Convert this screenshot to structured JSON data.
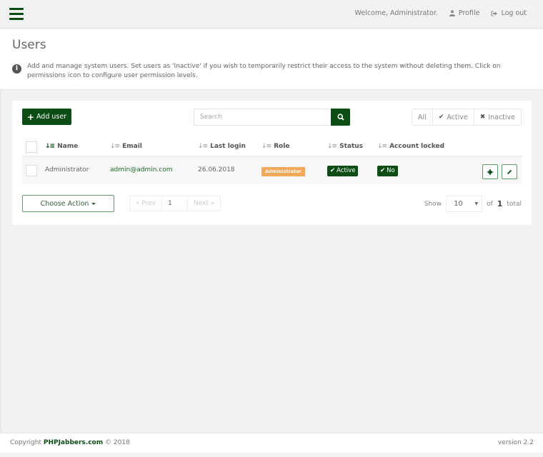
{
  "topbar": {
    "menu_icon": "hamburger-menu-icon",
    "welcome": "Welcome, Administrator.",
    "profile_label": "Profile",
    "profile_icon": "user-icon",
    "logout_label": "Log out",
    "logout_icon": "sign-out-icon"
  },
  "header": {
    "title": "Users",
    "info_icon": "info-circle-icon",
    "info_text": "Add and manage system users. Set users as 'Inactive' if you wish to temporarily restrict their access to the system without deleting them. Click on permissions icon to configure user permission levels."
  },
  "toolbar": {
    "add_user_label": "Add user",
    "search_placeholder": "Search",
    "search_value": "",
    "filters": [
      {
        "label": "All",
        "icon": ""
      },
      {
        "label": "Active",
        "icon": "check-icon"
      },
      {
        "label": "Inactive",
        "icon": "times-icon"
      }
    ]
  },
  "table": {
    "columns": [
      "Name",
      "Email",
      "Last login",
      "Role",
      "Status",
      "Account locked"
    ],
    "rows": [
      {
        "name": "Administrator",
        "email": "admin@admin.com",
        "last_login": "26.06.2018",
        "role": "Administrator",
        "status": "Active",
        "account_locked": "No"
      }
    ]
  },
  "bottom": {
    "choose_action": "Choose Action",
    "prev": "« Prev",
    "page": "1",
    "next": "Next »",
    "show_label": "Show",
    "per_page": "10",
    "of_label": "of",
    "total_count": "1",
    "total_label": "total"
  },
  "footer": {
    "copyright_prefix": "Copyright",
    "brand": "PHPJabbers.com",
    "copyright_suffix": "© 2018",
    "version": "version 2.2"
  },
  "colors": {
    "brand_green": "#0b4d14",
    "role_badge": "#f5a85a",
    "background": "#f2f2f4"
  }
}
